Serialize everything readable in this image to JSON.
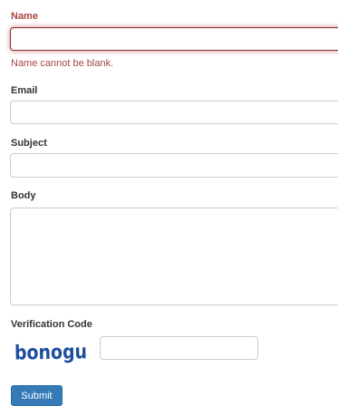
{
  "form": {
    "name_label": "Name",
    "name_value": "",
    "name_error": "Name cannot be blank.",
    "email_label": "Email",
    "email_value": "",
    "subject_label": "Subject",
    "subject_value": "",
    "body_label": "Body",
    "body_value": "",
    "verification_label": "Verification Code",
    "captcha_text": "bonogu",
    "verification_value": "",
    "submit_label": "Submit"
  },
  "colors": {
    "error": "#a94442",
    "primary": "#337ab7",
    "captcha": "#1d4e9e"
  }
}
